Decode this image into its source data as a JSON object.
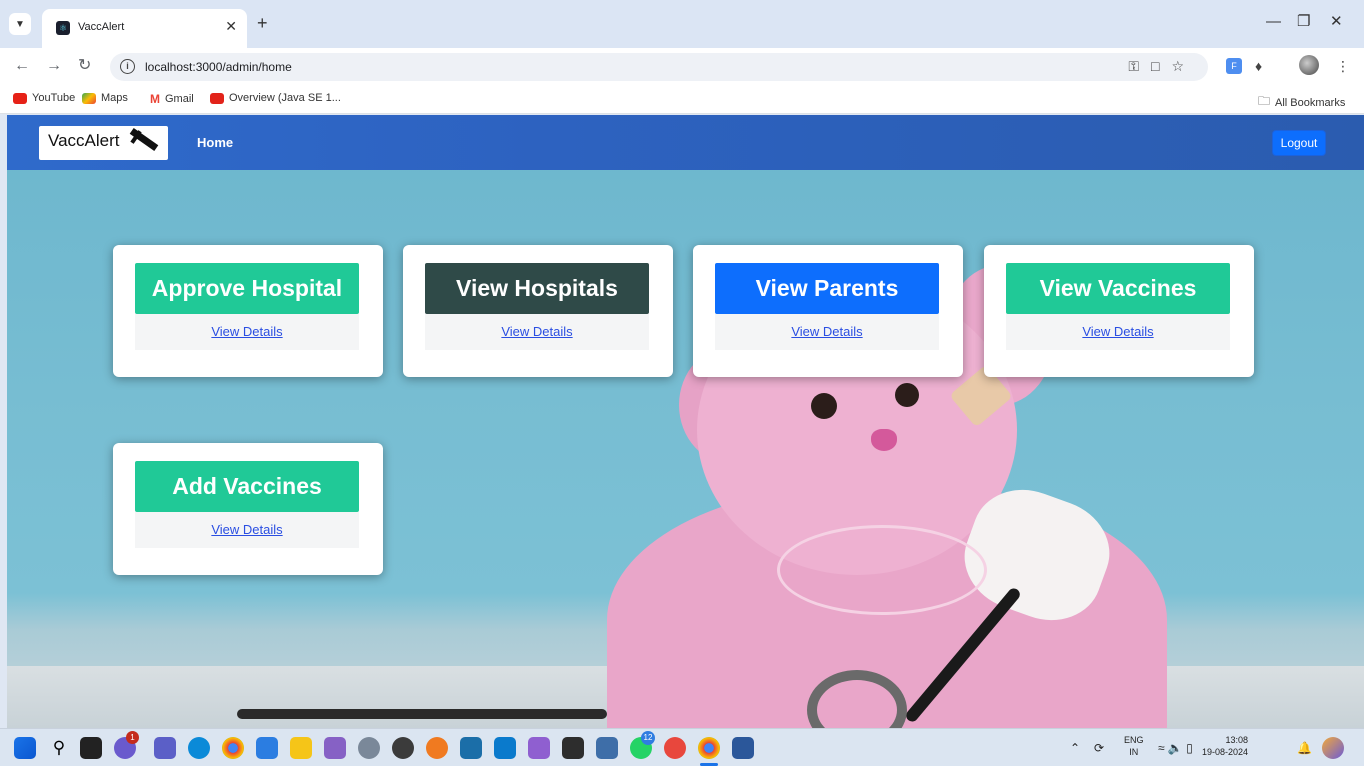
{
  "browser": {
    "tab_title": "VaccAlert",
    "url": "localhost:3000/admin/home",
    "bookmarks": [
      "YouTube",
      "Maps",
      "Gmail",
      "Overview (Java SE 1..."
    ],
    "all_bookmarks": "All Bookmarks"
  },
  "app": {
    "brand": "VaccAlert",
    "nav_home": "Home",
    "logout": "Logout",
    "cards": [
      {
        "title": "Approve Hospital",
        "link": "View Details",
        "color": "#20c997"
      },
      {
        "title": "View Hospitals",
        "link": "View Details",
        "color": "#2f4a48"
      },
      {
        "title": "View Parents",
        "link": "View Details",
        "color": "#0d6efd"
      },
      {
        "title": "View Vaccines",
        "link": "View Details",
        "color": "#20c997"
      },
      {
        "title": "Add Vaccines",
        "link": "View Details",
        "color": "#20c997"
      }
    ]
  },
  "taskbar": {
    "lang_top": "ENG",
    "lang_bottom": "IN",
    "time": "13:08",
    "date": "19-08-2024",
    "badges": {
      "notifications": "1",
      "whatsapp": "12"
    }
  },
  "colors": {
    "navbar": "#2f6acb",
    "logout_button": "#0d6efd",
    "link": "#2a4ee2"
  }
}
